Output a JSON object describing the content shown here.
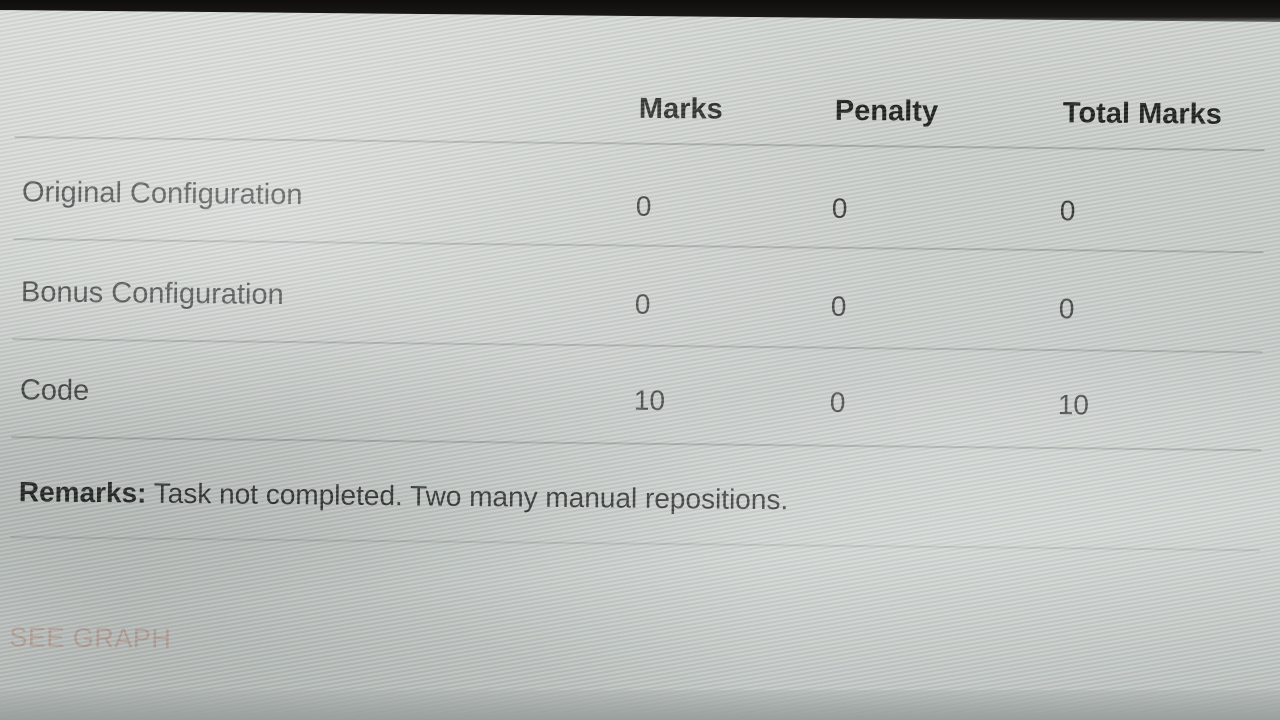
{
  "table": {
    "headers": [
      "Marks",
      "Penalty",
      "Total Marks"
    ],
    "rows": [
      {
        "label": "Original Configuration",
        "marks": "0",
        "penalty": "0",
        "total": "0"
      },
      {
        "label": "Bonus Configuration",
        "marks": "0",
        "penalty": "0",
        "total": "0"
      },
      {
        "label": "Code",
        "marks": "10",
        "penalty": "0",
        "total": "10"
      }
    ]
  },
  "remarks": {
    "label": "Remarks:",
    "text": " Task not completed. Two many manual repositions."
  },
  "actions": {
    "see_graph": "SEE GRAPH"
  },
  "colors": {
    "screen_bg": "#c9ceca",
    "text": "#2b2d2d",
    "link": "#be7864"
  }
}
